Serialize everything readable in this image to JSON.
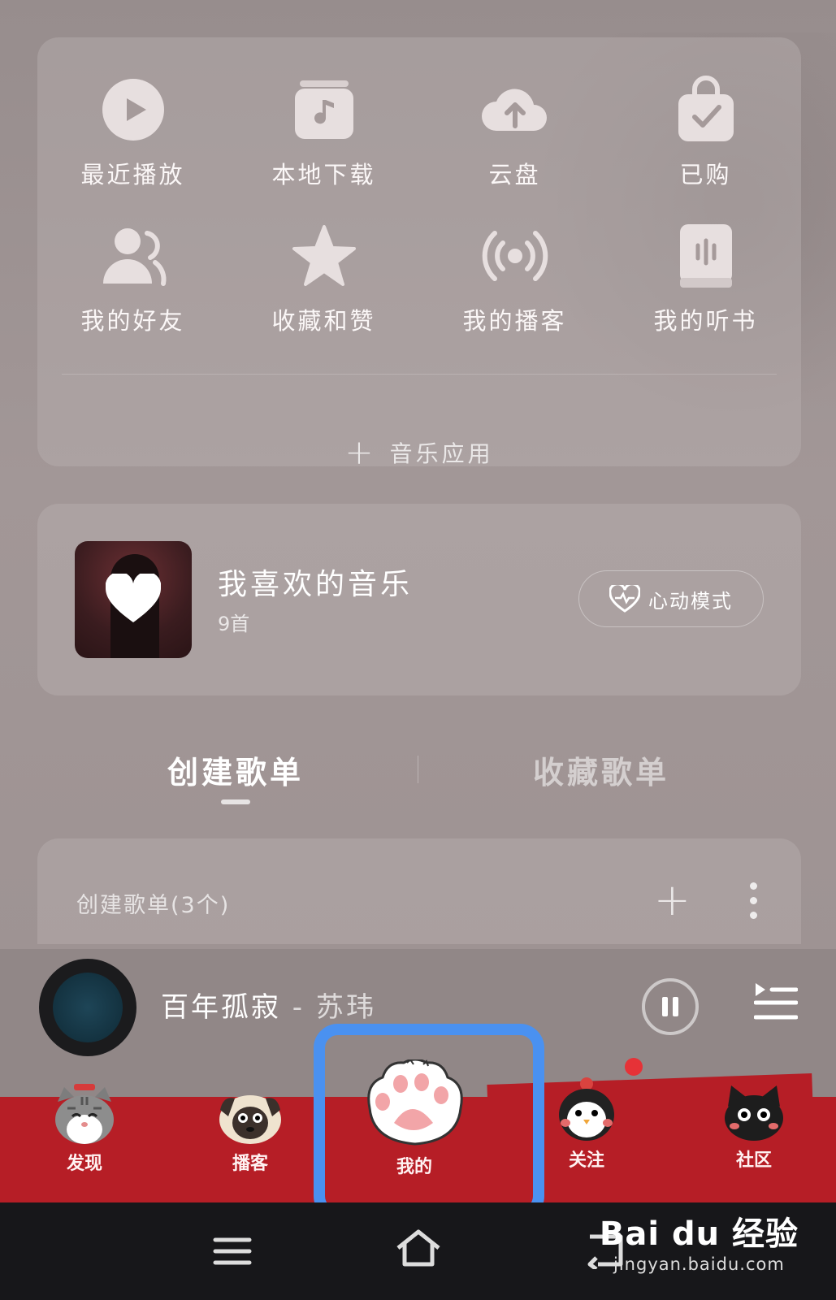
{
  "apps": [
    {
      "label": "最近播放",
      "icon": "play-icon"
    },
    {
      "label": "本地下载",
      "icon": "music-note-icon"
    },
    {
      "label": "云盘",
      "icon": "cloud-upload-icon"
    },
    {
      "label": "已购",
      "icon": "shopping-bag-icon"
    },
    {
      "label": "我的好友",
      "icon": "friends-icon"
    },
    {
      "label": "收藏和赞",
      "icon": "star-icon"
    },
    {
      "label": "我的播客",
      "icon": "broadcast-icon"
    },
    {
      "label": "我的听书",
      "icon": "audiobook-icon"
    }
  ],
  "add_app_label": "音乐应用",
  "favorites": {
    "title": "我喜欢的音乐",
    "count": "9首",
    "heart_mode_label": "心动模式"
  },
  "tabs": {
    "created": "创建歌单",
    "collected": "收藏歌单"
  },
  "playlist_header": "创建歌单(3个)",
  "now_playing": {
    "title": "百年孤寂",
    "separator": " - ",
    "artist": "苏玮"
  },
  "nav": [
    {
      "label": "发现",
      "icon": "cat-mascot-icon"
    },
    {
      "label": "播客",
      "icon": "pug-mascot-icon"
    },
    {
      "label": "我的",
      "icon": "paw-icon"
    },
    {
      "label": "关注",
      "icon": "penguin-mascot-icon"
    },
    {
      "label": "社区",
      "icon": "black-cat-mascot-icon"
    }
  ],
  "watermark": {
    "logo": "Bai du 经验",
    "url": "jingyan.baidu.com"
  },
  "colors": {
    "accent_red": "#b61e26",
    "highlight_blue": "#4a91f0"
  }
}
